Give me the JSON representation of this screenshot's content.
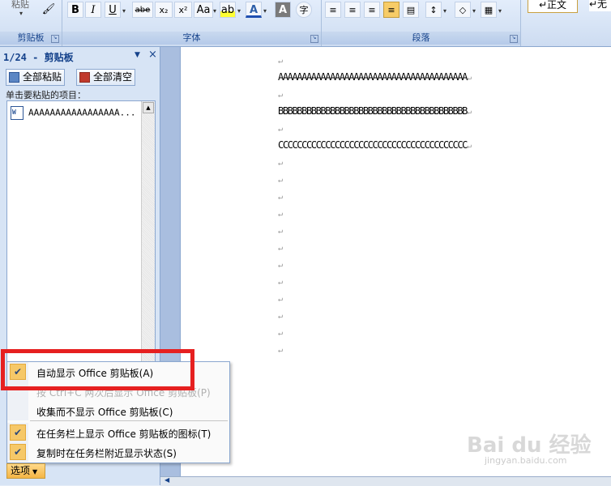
{
  "ribbon": {
    "paste_label": "粘贴",
    "groups": {
      "clipboard": "剪贴板",
      "font": "字体",
      "paragraph": "段落"
    },
    "font_buttons": {
      "bold": "B",
      "italic": "I",
      "underline": "U",
      "strikethrough": "abe",
      "subscript": "x₂",
      "superscript": "x²",
      "change_case": "Aa",
      "char_border": "A",
      "phonetic": "字"
    },
    "style_name": "↵正文",
    "style_name2": "↵无"
  },
  "clipboard_pane": {
    "title": "1/24 - 剪贴板",
    "paste_all": "全部粘贴",
    "clear_all": "全部清空",
    "hint": "单击要粘贴的项目：",
    "items": [
      {
        "text": "AAAAAAAAAAAAAAAAA..."
      }
    ],
    "options_button": "选项"
  },
  "document": {
    "lines": [
      "",
      "AAAAAAAAAAAAAAAAAAAAAAAAAAAAAAAAAAAAAAAA",
      "",
      "BBBBBBBBBBBBBBBBBBBBBBBBBBBBBBBBBBBBBBBB",
      "",
      "CCCCCCCCCCCCCCCCCCCCCCCCCCCCCCCCCCCCCCCC",
      "",
      "",
      "",
      "",
      "",
      "",
      "",
      "",
      "",
      "",
      "",
      ""
    ],
    "paragraph_mark": "↵"
  },
  "options_menu": {
    "items": [
      {
        "label": "自动显示 Office 剪贴板(A)",
        "checked": true,
        "disabled": false
      },
      {
        "label": "按 Ctrl+C 两次后显示 Office 剪贴板(P)",
        "checked": false,
        "disabled": true
      },
      {
        "label": "收集而不显示 Office 剪贴板(C)",
        "checked": false,
        "disabled": false
      },
      {
        "label": "在任务栏上显示 Office 剪贴板的图标(T)",
        "checked": true,
        "disabled": false
      },
      {
        "label": "复制时在任务栏附近显示状态(S)",
        "checked": true,
        "disabled": false
      }
    ]
  },
  "watermark": {
    "text": "Bai du 经验",
    "sub": "jingyan.baidu.com"
  },
  "colors": {
    "highlight_box": "#e62020",
    "check_bg": "#f6c868",
    "ribbon_text": "#15428b"
  }
}
